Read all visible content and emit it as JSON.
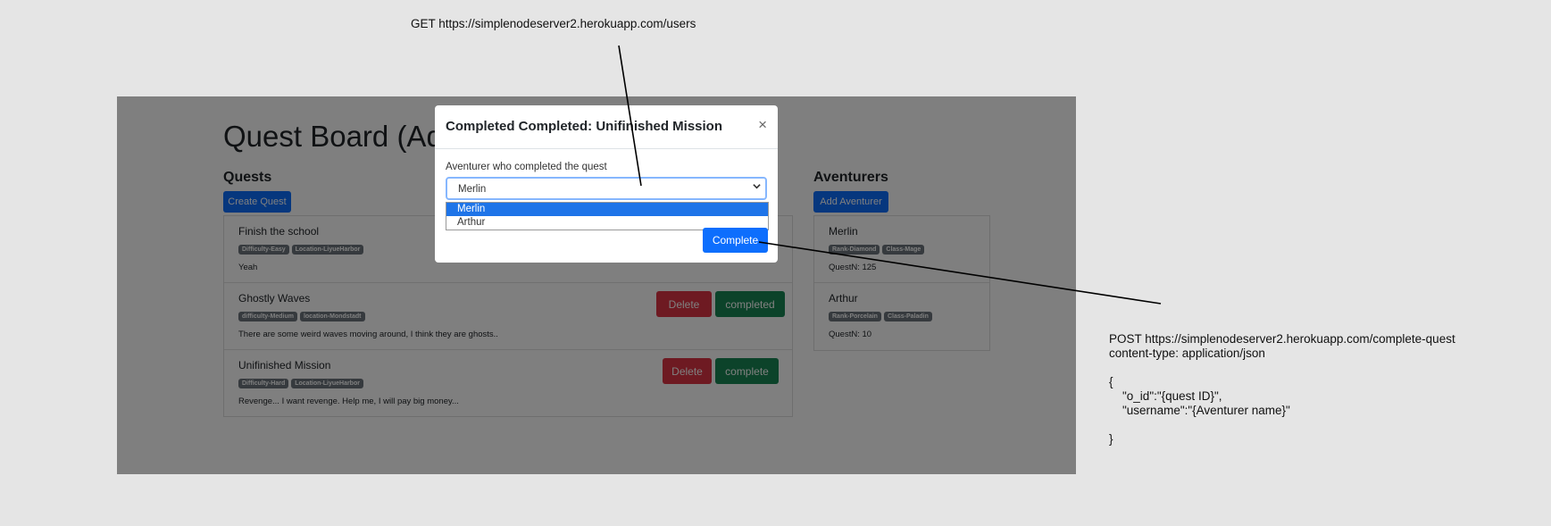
{
  "annotations": {
    "get_request": "GET https://simplenodeserver2.herokuapp.com/users",
    "post_request": "POST https://simplenodeserver2.herokuapp.com/complete-quest\ncontent-type: application/json\n\n{\n    \"o_id\":\"{quest ID}\",\n    \"username\":\"{Aventurer name}\"\n\n}"
  },
  "page": {
    "title": "Quest Board (Admin)",
    "quests_title": "Quests",
    "create_quest_label": "Create Quest",
    "adventurers_title": "Aventurers",
    "add_adventurer_label": "Add Aventurer"
  },
  "quests": [
    {
      "name": "Finish the school",
      "badges": [
        "Difficulty-Easy",
        "Location-LiyueHarbor"
      ],
      "description": "Yeah",
      "delete_label": "",
      "action_label": ""
    },
    {
      "name": "Ghostly Waves",
      "badges": [
        "difficulty-Medium",
        "location-Mondstadt"
      ],
      "description": "There are some weird waves moving around, I think they are ghosts..",
      "delete_label": "Delete",
      "action_label": "completed"
    },
    {
      "name": "Unifinished Mission",
      "badges": [
        "Difficulty-Hard",
        "Location-LiyueHarbor"
      ],
      "description": "Revenge... I want revenge. Help me, I will pay big money...",
      "delete_label": "Delete",
      "action_label": "complete"
    }
  ],
  "adventurers": [
    {
      "name": "Merlin",
      "badges": [
        "Rank-Diamond",
        "Class-Mage"
      ],
      "quests": "QuestN: 125"
    },
    {
      "name": "Arthur",
      "badges": [
        "Rank-Porcelain",
        "Class-Paladin"
      ],
      "quests": "QuestN: 10"
    }
  ],
  "modal": {
    "title": "Completed Completed: Unifinished Mission",
    "close_symbol": "×",
    "field_label": "Aventurer who completed the quest",
    "selected_value": "Merlin",
    "options": [
      "Merlin",
      "Arthur"
    ],
    "submit_label": "Complete"
  },
  "colors": {
    "primary": "#0d6efd",
    "danger": "#dc3545",
    "success": "#198754",
    "badge": "#6c757d",
    "overlay": "rgba(0,0,0,0.5)",
    "background": "#e5e5e5"
  },
  "icons": {
    "close": "close-icon",
    "select_caret": "chevron-down-icon"
  }
}
